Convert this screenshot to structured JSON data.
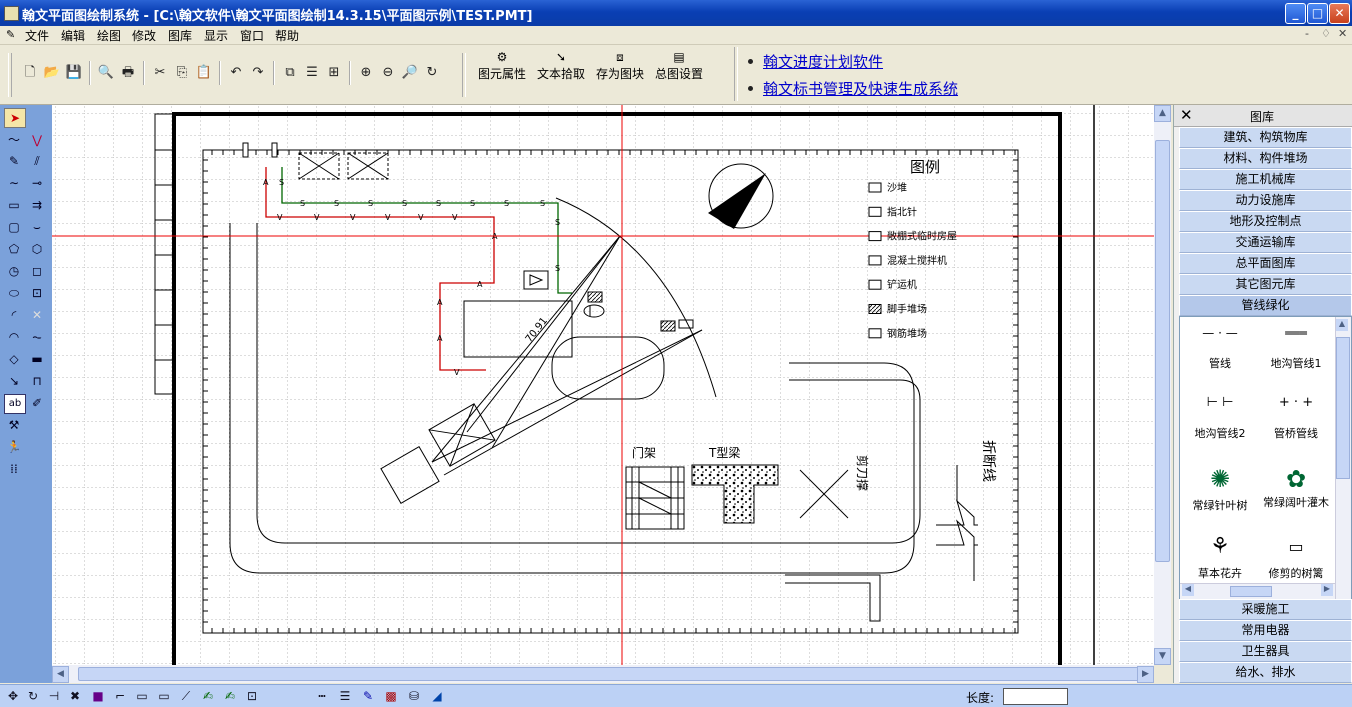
{
  "window": {
    "title": "翰文平面图绘制系统 - [C:\\翰文软件\\翰文平面图绘制14.3.15\\平面图示例\\TEST.PMT]",
    "min_glyph": "_",
    "max_glyph": "□",
    "close_glyph": "✕"
  },
  "menu": [
    "文件",
    "编辑",
    "绘图",
    "修改",
    "图库",
    "显示",
    "窗口",
    "帮助"
  ],
  "mdi_controls": [
    "-",
    "♢",
    "✕"
  ],
  "toolbar": {
    "icons": [
      "new-file-icon",
      "open-folder-icon",
      "save-icon",
      "print-preview-icon",
      "print-icon",
      "cut-icon",
      "copy-icon",
      "paste-icon",
      "undo-icon",
      "redo-icon",
      "layer-front-icon",
      "layer-middle-icon",
      "layer-back-icon",
      "zoom-in-icon",
      "zoom-out-icon",
      "zoom-window-icon",
      "zoom-refresh-icon"
    ],
    "labeled": [
      {
        "label": "图元属性",
        "icon": "element-properties-icon"
      },
      {
        "label": "文本拾取",
        "icon": "text-pick-icon"
      },
      {
        "label": "存为图块",
        "icon": "save-block-icon"
      },
      {
        "label": "总图设置",
        "icon": "drawing-settings-icon"
      }
    ],
    "links": [
      "翰文进度计划软件",
      "翰文标书管理及快速生成系统"
    ]
  },
  "left_tools": [
    "select-arrow-icon",
    "polyline-icon",
    "freehand-icon",
    "pen-icon",
    "hatch-line-icon",
    "curve-icon",
    "dimension-icon",
    "rectangle-icon",
    "arrow-line-icon",
    "rounded-rect-icon",
    "rounded-line-icon",
    "pentagon-icon",
    "hexagon-icon",
    "clock-icon",
    "square-icon",
    "ellipse-icon",
    "block-icon",
    "arc-icon",
    "cross-mark-icon",
    "half-circle-icon",
    "break-line-icon",
    "diamond-icon",
    "pipe-icon",
    "route-icon",
    "frame-icon",
    "text-icon",
    "edit-tool-icon",
    "wrench-icon",
    "runner-icon",
    "grid-dots-icon"
  ],
  "drawing": {
    "legend_title": "图例",
    "legend_items": [
      "沙堆",
      "指北针",
      "敞棚式临时房屋",
      "混凝土搅拌机",
      "铲运机",
      "脚手堆场",
      "钢筋堆场"
    ],
    "labels": {
      "radius": "70.91",
      "gate_frame": "门架",
      "t_beam": "T型梁",
      "scissor": "剪刀撑",
      "break_line": "折断线"
    },
    "pipe_markers": {
      "s": "S",
      "v": "V",
      "a": "A"
    }
  },
  "library": {
    "header": "图库",
    "close_glyph": "✕",
    "categories_top": [
      "建筑、构筑物库",
      "材料、构件堆场",
      "施工机械库",
      "动力设施库",
      "地形及控制点",
      "交通运输库",
      "总平面图库",
      "其它图元库",
      "管线绿化"
    ],
    "symbols": [
      "管线",
      "地沟管线1",
      "地沟管线2",
      "管桥管线",
      "常绿针叶树",
      "常绿阔叶灌木",
      "草本花卉",
      "修剪的树篱"
    ],
    "categories_bottom": [
      "采暖施工",
      "常用电器",
      "卫生器具",
      "给水、排水"
    ]
  },
  "statusbar": {
    "icons": [
      "move-icon",
      "rotate-icon",
      "mirror-icon",
      "trim-icon",
      "point-icon",
      "fillet-icon",
      "rect-tool-icon",
      "rect-tool2-icon",
      "line-tool-icon",
      "text-tool-icon",
      "text-tool2-icon",
      "frame-tool-icon",
      "line-style-icon",
      "line-width-icon",
      "color-icon",
      "hatch-icon",
      "fill-icon",
      "arrow-icon"
    ],
    "length_label": "长度:",
    "length_value": ""
  }
}
